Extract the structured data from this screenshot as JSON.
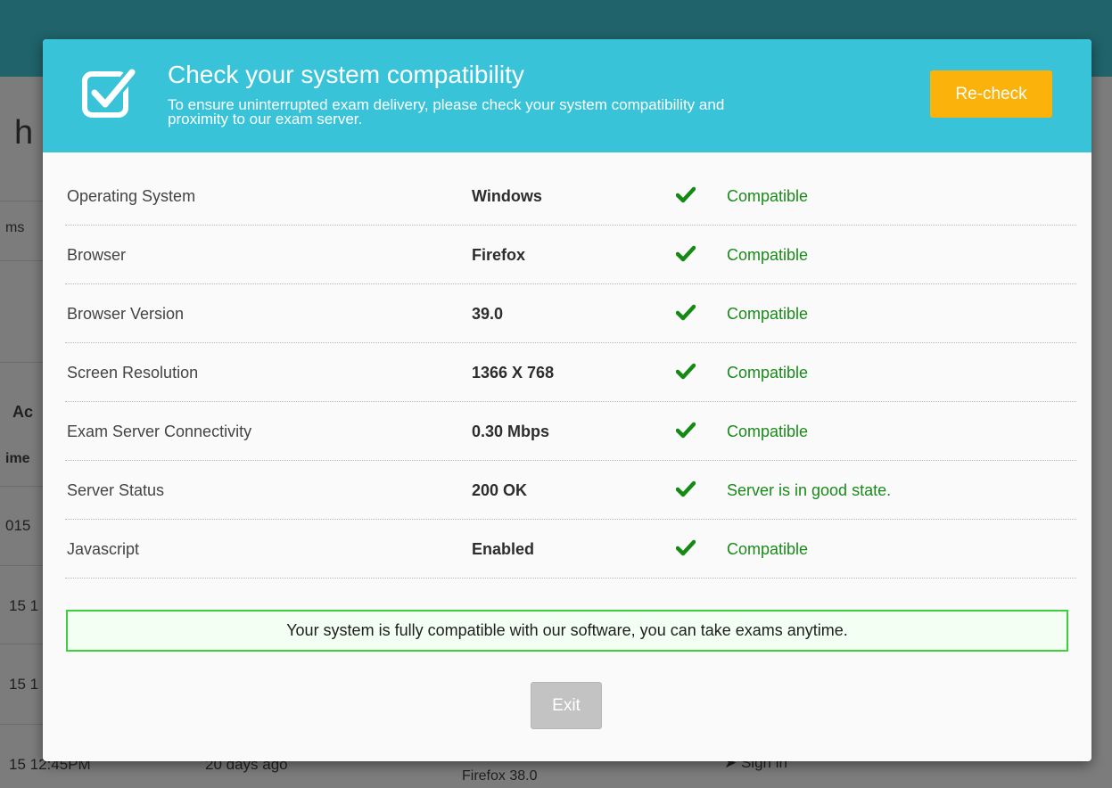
{
  "background": {
    "heading_fragment": "h",
    "tab_fragment": "ms",
    "section_fragment": "Ac",
    "column_fragment": "ime",
    "row_fragments": [
      "015",
      "15 1",
      "15 1",
      "15 12:45PM"
    ],
    "relative_time": "20 days ago",
    "browser_cell": "Firefox 38.0",
    "action_cell": "Sign in"
  },
  "modal": {
    "title": "Check your system compatibility",
    "subtitle": "To ensure uninterrupted exam delivery, please check your system compatibility and proximity to our exam server.",
    "recheck_label": "Re-check",
    "header_icon": "checkbox-checked-icon",
    "rows": [
      {
        "label": "Operating System",
        "value": "Windows",
        "status": "Compatible"
      },
      {
        "label": "Browser",
        "value": "Firefox",
        "status": "Compatible"
      },
      {
        "label": "Browser Version",
        "value": "39.0",
        "status": "Compatible"
      },
      {
        "label": "Screen Resolution",
        "value": "1366 X 768",
        "status": "Compatible"
      },
      {
        "label": "Exam Server Connectivity",
        "value": "0.30 Mbps",
        "status": "Compatible"
      },
      {
        "label": "Server Status",
        "value": "200 OK",
        "status": "Server is in good state."
      },
      {
        "label": "Javascript",
        "value": "Enabled",
        "status": "Compatible"
      }
    ],
    "notice": "Your system is fully compatible with our software, you can take exams anytime.",
    "exit_label": "Exit"
  },
  "colors": {
    "header": "#38c3d8",
    "recheck": "#fbb20b",
    "status_ok": "#1a8a1a",
    "notice_border": "#3dd03d",
    "exit_disabled": "#c3c3c3"
  }
}
